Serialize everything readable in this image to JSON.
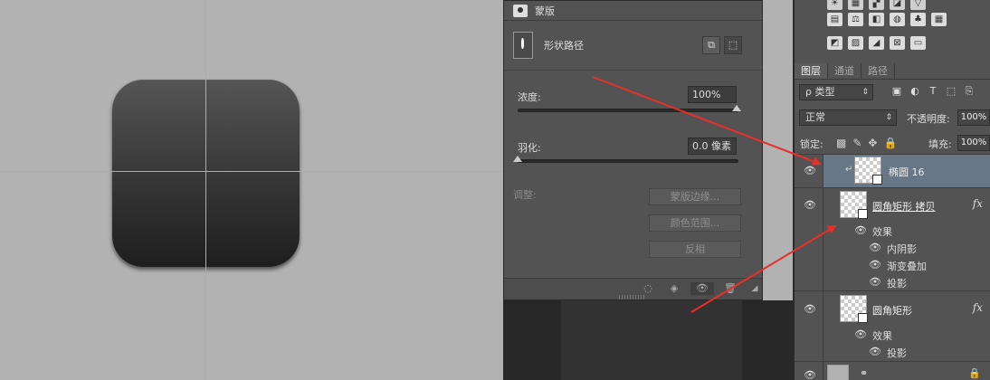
{
  "properties": {
    "header_title": "蒙版",
    "shape_label": "形状路径",
    "density_label": "浓度:",
    "density_value": "100%",
    "feather_label": "羽化:",
    "feather_value": "0.0 像素",
    "adjust_label": "调整:",
    "mask_edge_btn": "蒙版边缘...",
    "color_range_btn": "颜色范围...",
    "invert_btn": "反相"
  },
  "layers_panel": {
    "tabs": [
      "图层",
      "通道",
      "路径"
    ],
    "filter_kind": "ρ 类型",
    "blend_mode": "正常",
    "opacity_label": "不透明度:",
    "opacity_value": "100%",
    "lock_label": "锁定:",
    "fill_label": "填充:",
    "fill_value": "100%",
    "layers": [
      {
        "name": "椭圆 16",
        "selected": true
      },
      {
        "name": "圆角矩形 拷贝",
        "fx": "fx",
        "effects_label": "效果",
        "effects": [
          "内阴影",
          "渐变叠加",
          "投影"
        ]
      },
      {
        "name": "圆角矩形",
        "fx": "fx",
        "effects_label": "效果",
        "effects": [
          "投影"
        ]
      }
    ]
  },
  "colors": {
    "canvas_bg": "#b2b2b2",
    "guide": "#3fd8e8",
    "panel_bg": "#535353",
    "selected_layer": "#677786",
    "arrow": "#e8302a"
  }
}
